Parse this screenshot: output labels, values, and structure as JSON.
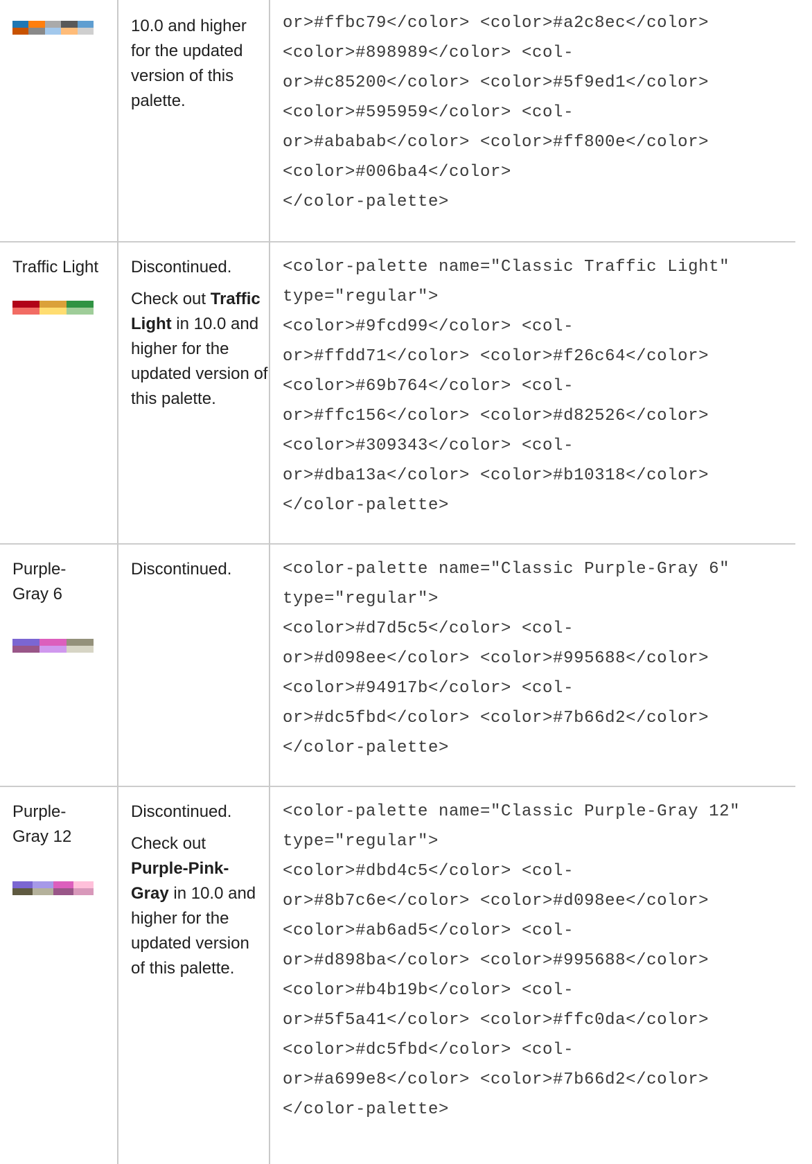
{
  "rows": [
    {
      "name": "",
      "swatch": [
        "#1f77b4",
        "#ff7f0e",
        "#aaaaaa",
        "#595959",
        "#5f9ed1",
        "#c85200",
        "#898989",
        "#a2c8ec",
        "#ffbc79",
        "#cfcfcf"
      ],
      "desc": [
        {
          "text": "10.0 and higher for the updated version of this palette."
        }
      ],
      "code_lines": [
        "or>#ffbc79</color> <color>#a2c8ec</color>",
        "<color>#898989</color> <col-",
        "or>#c85200</color> <color>#5f9ed1</color>",
        "<color>#595959</color> <col-",
        "or>#ababab</color> <color>#ff800e</color>",
        "<color>#006ba4</color>",
        "</color-palette>"
      ]
    },
    {
      "name": "Traffic Light",
      "swatch": [
        "#b10318",
        "#dba13a",
        "#309343",
        "#f26c64",
        "#ffdd71",
        "#9fcd99"
      ],
      "desc_line1": "Discontinued.",
      "desc_pre": "Check out ",
      "desc_bold": "Traffic Light",
      "desc_post": " in 10.0 and higher for the updated version of this palette.",
      "code_lines": [
        "<color-palette name=\"Classic Traffic Light\"",
        "type=\"regular\">",
        "<color>#9fcd99</color> <col-",
        "or>#ffdd71</color> <color>#f26c64</color>",
        "<color>#69b764</color> <col-",
        "or>#ffc156</color> <color>#d82526</color>",
        "<color>#309343</color> <col-",
        "or>#dba13a</color> <color>#b10318</color>",
        "</color-palette>"
      ]
    },
    {
      "name": "Purple-Gray 6",
      "swatch": [
        "#7b66d2",
        "#dc5fbd",
        "#94917b",
        "#995688",
        "#d098ee",
        "#d7d5c5"
      ],
      "desc_line1": "Discontinued.",
      "code_lines": [
        "<color-palette name=\"Classic Purple-Gray 6\"",
        "type=\"regular\">",
        "<color>#d7d5c5</color> <col-",
        "or>#d098ee</color> <color>#995688</color>",
        "<color>#94917b</color> <col-",
        "or>#dc5fbd</color> <color>#7b66d2</color>",
        "</color-palette>"
      ]
    },
    {
      "name": "Purple-Gray 12",
      "swatch": [
        "#7b66d2",
        "#a699e8",
        "#dc5fbd",
        "#ffc0da",
        "#5f5a41",
        "#b4b19b",
        "#995688",
        "#d898ba",
        "#ab6ad5",
        "#d098ee",
        "#8b7c6e",
        "#dbd4c5"
      ],
      "desc_line1": "Discontinued.",
      "desc_pre": "Check out ",
      "desc_bold": "Purple-Pink-Gray",
      "desc_post": " in 10.0 and higher for the updated version of this palette.",
      "code_lines": [
        "<color-palette name=\"Classic Purple-Gray 12\"",
        "type=\"regular\">",
        "<color>#dbd4c5</color> <col-",
        "or>#8b7c6e</color> <color>#d098ee</color>",
        "<color>#ab6ad5</color> <col-",
        "or>#d898ba</color> <color>#995688</color>",
        "<color>#b4b19b</color> <col-",
        "or>#5f5a41</color> <color>#ffc0da</color>",
        "<color>#dc5fbd</color> <col-",
        "or>#a699e8</color> <color>#7b66d2</color>",
        "</color-palette>"
      ]
    }
  ]
}
